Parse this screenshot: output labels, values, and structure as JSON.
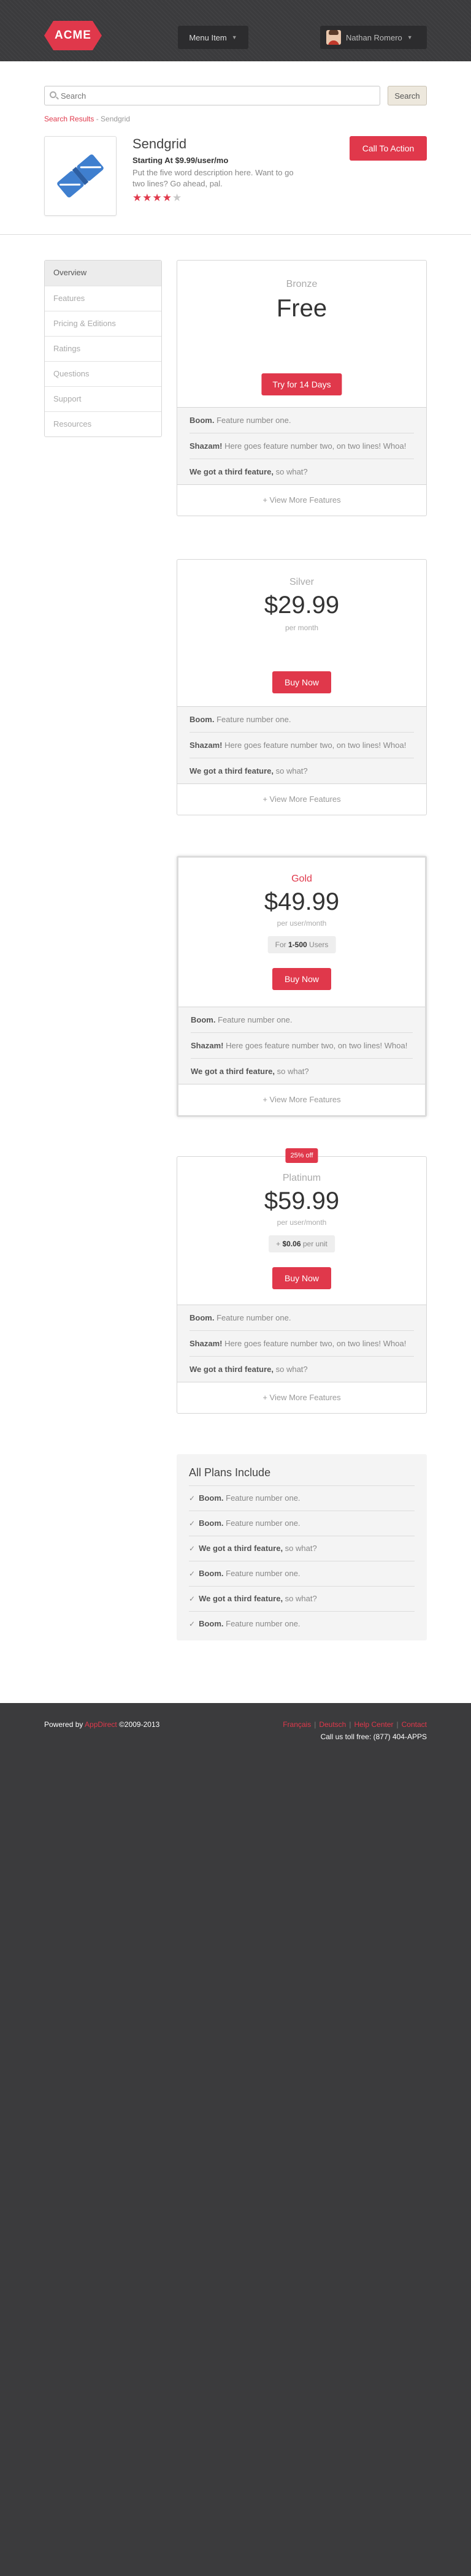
{
  "header": {
    "logo_text": "ACME",
    "menu_label": "Menu Item",
    "user_name": "Nathan Romero"
  },
  "search": {
    "placeholder": "Search",
    "button_label": "Search"
  },
  "breadcrumb": {
    "link": "Search Results",
    "separator": " - ",
    "current": "Sendgrid"
  },
  "product": {
    "name": "Sendgrid",
    "price_line": "Starting At $9.99/user/mo",
    "description": "Put the five word description here. Want to go two lines? Go ahead, pal.",
    "rating": 4,
    "rating_max": 5,
    "cta_label": "Call To Action"
  },
  "sidenav": {
    "items": [
      {
        "label": "Overview",
        "active": true
      },
      {
        "label": "Features",
        "active": false
      },
      {
        "label": "Pricing & Editions",
        "active": false
      },
      {
        "label": "Ratings",
        "active": false
      },
      {
        "label": "Questions",
        "active": false
      },
      {
        "label": "Support",
        "active": false
      },
      {
        "label": "Resources",
        "active": false
      }
    ]
  },
  "feature_texts": {
    "f1_bold": "Boom.",
    "f1_rest": " Feature number one.",
    "f2_bold": "Shazam!",
    "f2_rest": " Here goes feature number two, on two lines! Whoa!",
    "f3_bold": "We got a third feature,",
    "f3_rest": " so what?",
    "view_more": "+ View More Features"
  },
  "plans": [
    {
      "name": "Bronze",
      "price": "Free",
      "button": "Try for 14 Days"
    },
    {
      "name": "Silver",
      "price": "$29.99",
      "period": "per month",
      "button": "Buy Now"
    },
    {
      "name": "Gold",
      "price": "$49.99",
      "period": "per user/month",
      "note_prefix": "For ",
      "note_bold": "1-500",
      "note_suffix": " Users",
      "button": "Buy Now"
    },
    {
      "name": "Platinum",
      "badge": "25% off",
      "price": "$59.99",
      "period": "per user/month",
      "note_prefix": "+ ",
      "note_bold": "$0.06",
      "note_suffix": " per unit",
      "button": "Buy Now"
    }
  ],
  "all_plans": {
    "title": "All Plans Include",
    "items": [
      {
        "bold": "Boom.",
        "rest": " Feature number one."
      },
      {
        "bold": "Boom.",
        "rest": " Feature number one."
      },
      {
        "bold": "We got a third feature,",
        "rest": " so what?"
      },
      {
        "bold": "Boom.",
        "rest": " Feature number one."
      },
      {
        "bold": "We got a third feature,",
        "rest": " so what?"
      },
      {
        "bold": "Boom.",
        "rest": " Feature number one."
      }
    ]
  },
  "footer": {
    "powered_prefix": "Powered by ",
    "powered_brand": "AppDirect",
    "powered_suffix": " ©2009-2013",
    "links": [
      "Français",
      "Deutsch",
      "Help Center",
      "Contact"
    ],
    "link_separator": "|",
    "phone": "Call us toll free: (877) 404-APPS"
  },
  "colors": {
    "accent": "#e0384b",
    "topbar": "#3b3b3d",
    "footer": "#3b3b3d"
  }
}
